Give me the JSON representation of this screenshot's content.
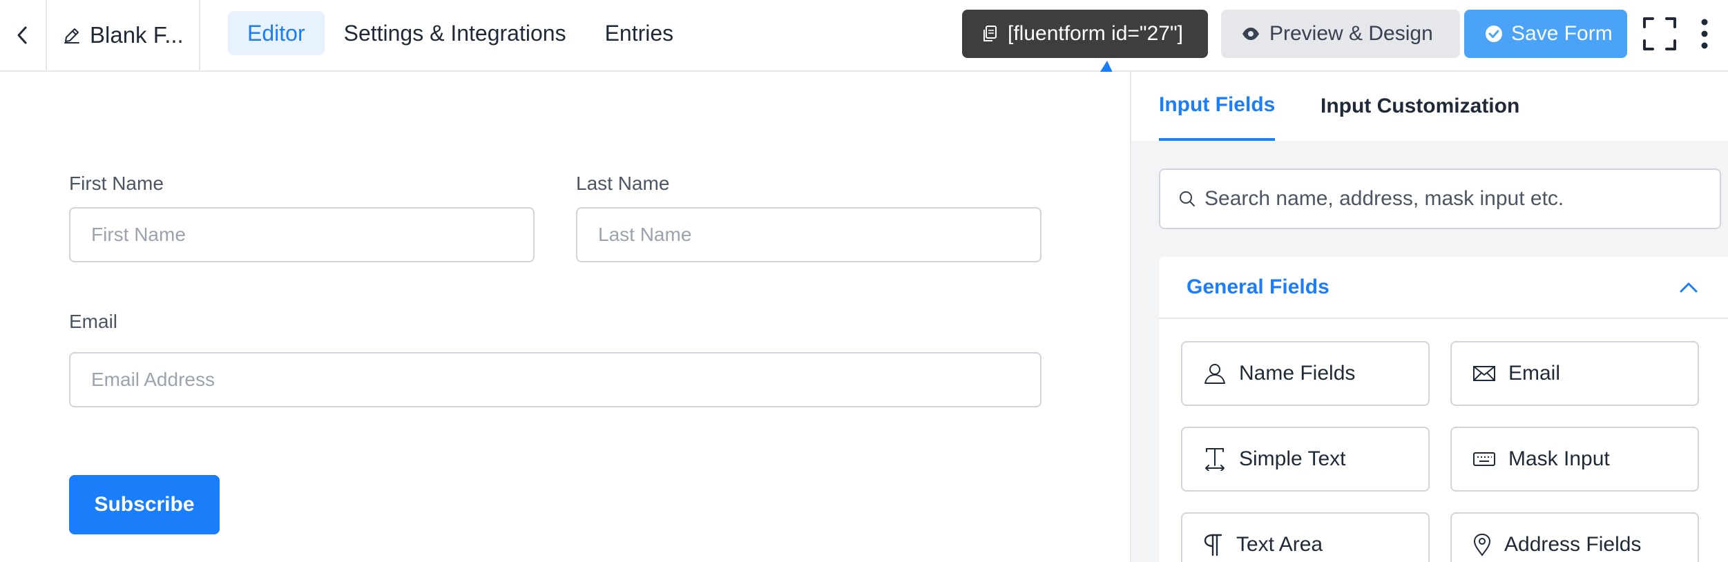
{
  "header": {
    "form_title": "Blank F...",
    "tabs": [
      {
        "label": "Editor",
        "active": true
      },
      {
        "label": "Settings & Integrations",
        "active": false
      },
      {
        "label": "Entries",
        "active": false
      }
    ],
    "shortcode": "[fluentform id=\"27\"]",
    "preview_label": "Preview & Design",
    "save_label": "Save Form"
  },
  "form": {
    "first_name_label": "First Name",
    "first_name_placeholder": "First Name",
    "last_name_label": "Last Name",
    "last_name_placeholder": "Last Name",
    "email_label": "Email",
    "email_placeholder": "Email Address",
    "submit_label": "Subscribe"
  },
  "sidebar": {
    "tabs": [
      {
        "label": "Input Fields",
        "active": true
      },
      {
        "label": "Input Customization",
        "active": false
      }
    ],
    "search_placeholder": "Search name, address, mask input etc.",
    "section_title": "General Fields",
    "fields": [
      {
        "label": "Name Fields",
        "icon": "person-icon"
      },
      {
        "label": "Email",
        "icon": "envelope-icon"
      },
      {
        "label": "Simple Text",
        "icon": "text-cursor-icon"
      },
      {
        "label": "Mask Input",
        "icon": "keyboard-icon"
      },
      {
        "label": "Text Area",
        "icon": "paragraph-icon"
      },
      {
        "label": "Address Fields",
        "icon": "map-pin-icon"
      }
    ]
  },
  "colors": {
    "accent": "#1a7efb",
    "save_button": "#4aa3f7",
    "shortcode_bg": "#3e3e3e",
    "active_tab_bg": "#e8f2fd"
  }
}
